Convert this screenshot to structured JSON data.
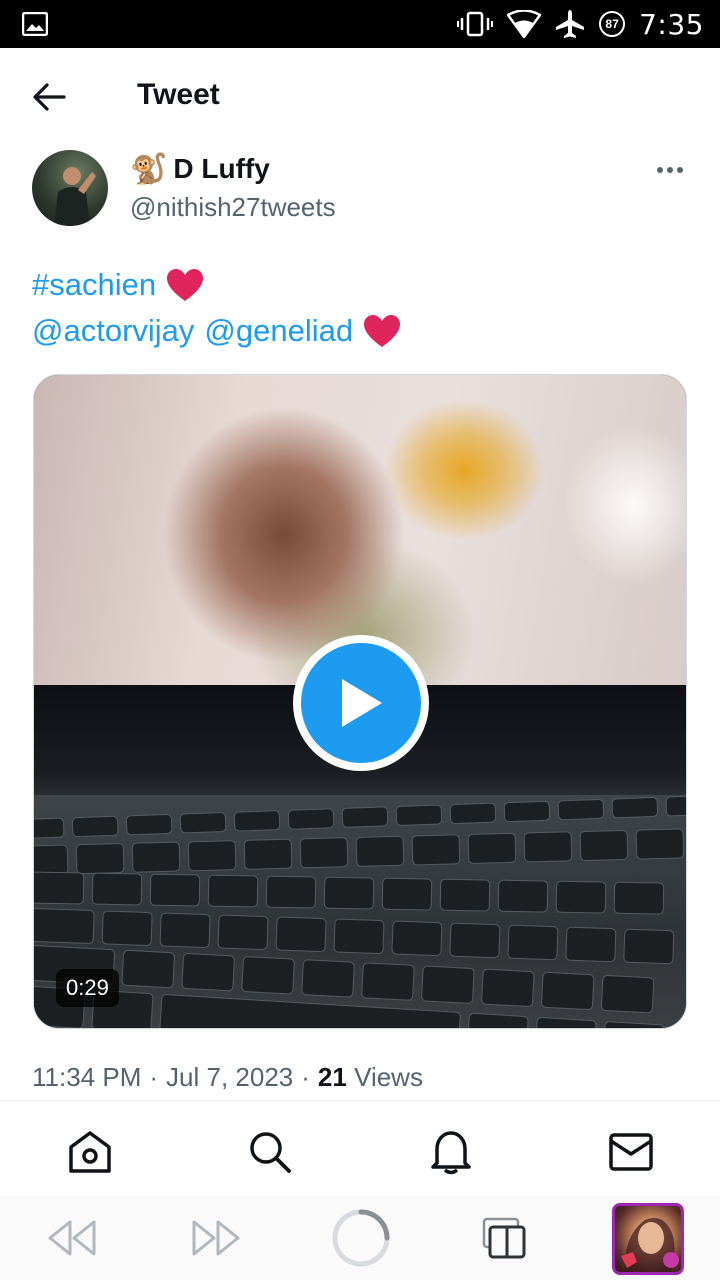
{
  "status_bar": {
    "time": "7:35",
    "battery_level": "87",
    "icons": [
      "image-icon",
      "vibrate-icon",
      "wifi-icon",
      "airplane-icon",
      "battery-saver-icon"
    ]
  },
  "header": {
    "title": "Tweet",
    "back_icon": "arrow-left-icon"
  },
  "author": {
    "emoji": "🐒",
    "display_name": "D Luffy",
    "handle": "@nithish27tweets"
  },
  "tweet": {
    "hashtag": "#sachien",
    "mention_1": "@actorvijay",
    "mention_2": "@geneliad",
    "heart_color": "#e0245e"
  },
  "media": {
    "duration": "0:29",
    "play_color": "#1d9bf0"
  },
  "meta": {
    "time": "11:34 PM",
    "separator": "·",
    "date": "Jul 7, 2023",
    "views_count": "21",
    "views_label": "Views"
  },
  "tabs": [
    {
      "name": "home",
      "icon": "home-icon"
    },
    {
      "name": "search",
      "icon": "search-icon"
    },
    {
      "name": "notifications",
      "icon": "bell-icon"
    },
    {
      "name": "messages",
      "icon": "mail-icon"
    }
  ],
  "bottom_toolbar": {
    "icons": [
      "rewind-icon",
      "fast-forward-icon",
      "loading-icon",
      "tabs-icon",
      "thumbnail"
    ]
  },
  "colors": {
    "accent": "#1d9bf0",
    "text_primary": "#0f1419",
    "text_secondary": "#536471"
  }
}
